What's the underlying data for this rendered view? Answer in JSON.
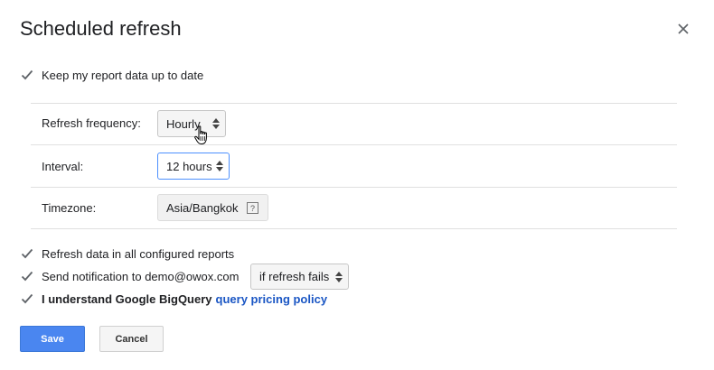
{
  "dialog": {
    "title": "Scheduled refresh"
  },
  "options": {
    "keep_up_to_date": {
      "label": "Keep my report data up to date",
      "checked": true
    },
    "refresh_all": {
      "label": "Refresh data in all configured reports",
      "checked": true
    },
    "send_notification": {
      "label": "Send notification to demo@owox.com",
      "checked": true
    },
    "understand_pricing": {
      "label": "I understand Google BigQuery",
      "link": "query pricing policy",
      "checked": true
    }
  },
  "fields": {
    "frequency": {
      "label": "Refresh frequency:",
      "value": "Hourly"
    },
    "interval": {
      "label": "Interval:",
      "value": "12 hours"
    },
    "timezone": {
      "label": "Timezone:",
      "value": "Asia/Bangkok"
    },
    "notify_when": {
      "value": "if refresh fails"
    }
  },
  "buttons": {
    "save": "Save",
    "cancel": "Cancel"
  },
  "colors": {
    "primary": "#4a86f0",
    "link": "#1a56c4",
    "focus": "#4d90fe"
  },
  "icons": {
    "close": "close-icon",
    "checkbox": "checkmark-icon",
    "select_arrows": "up-down-arrows-icon",
    "help": "help-icon",
    "cursor": "hand-pointer-icon"
  }
}
